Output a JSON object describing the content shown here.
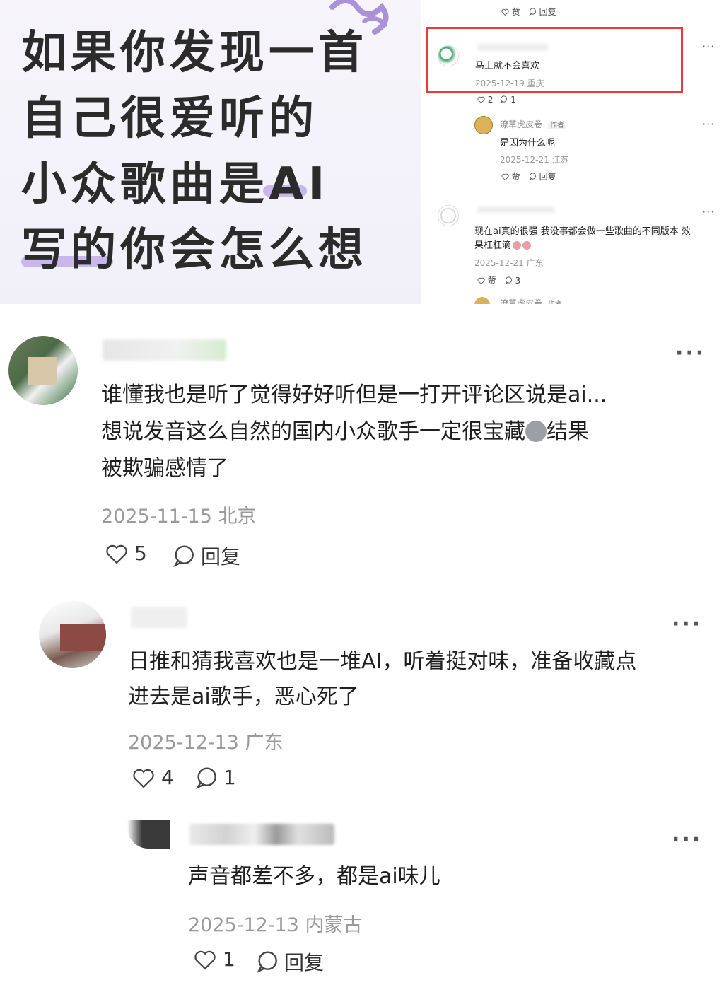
{
  "poster": {
    "lines": [
      "如果你发现一首",
      "自己很爱听的",
      "小众歌曲是AI",
      "写的你会怎么想"
    ]
  },
  "thread_top": {
    "prev_actions": {
      "like": "赞",
      "reply": "回复"
    },
    "highlighted": {
      "text": "马上就不会喜欢",
      "date": "2025-12-19",
      "location": "重庆",
      "likes": "2",
      "replies": "1"
    },
    "author_reply": {
      "name": "潦草虎皮卷",
      "badge": "作者",
      "text": "是因为什么呢",
      "date": "2025-12-21",
      "location": "江苏",
      "like": "赞",
      "reply": "回复"
    },
    "third": {
      "text_line1": "现在ai真的很强 我没事都会做一些歌曲的不同版本 效",
      "text_line2": "果杠杠滴",
      "date": "2025-12-21",
      "location": "广东",
      "like": "赞",
      "replies": "3"
    },
    "cut_name": "潦草虎皮卷",
    "cut_badge": "作者"
  },
  "comments": [
    {
      "lines": [
        "谁懂我也是听了觉得好好听但是一打开评论区说是ai...",
        "想说发音这么自然的国内小众歌手一定很宝藏",
        "被欺骗感情了"
      ],
      "line2_suffix": "结果",
      "date": "2025-11-15",
      "location": "北京",
      "likes": "5",
      "reply_label": "回复"
    },
    {
      "lines": [
        "日推和猜我喜欢也是一堆AI，听着挺对味，准备收藏点",
        "进去是ai歌手，恶心死了"
      ],
      "date": "2025-12-13",
      "location": "广东",
      "likes": "4",
      "replies": "1"
    },
    {
      "lines": [
        "声音都差不多，都是ai味儿"
      ],
      "date": "2025-12-13",
      "location": "内蒙古",
      "likes": "1",
      "reply_label": "回复"
    }
  ],
  "colors": {
    "highlight_border": "#e83b3b",
    "underline_purple": "#c7b7ec",
    "meta_gray": "#9a9a9a"
  },
  "icons": [
    "heart-icon",
    "comment-bubble-icon",
    "more-dots-icon",
    "squiggle-decoration"
  ]
}
